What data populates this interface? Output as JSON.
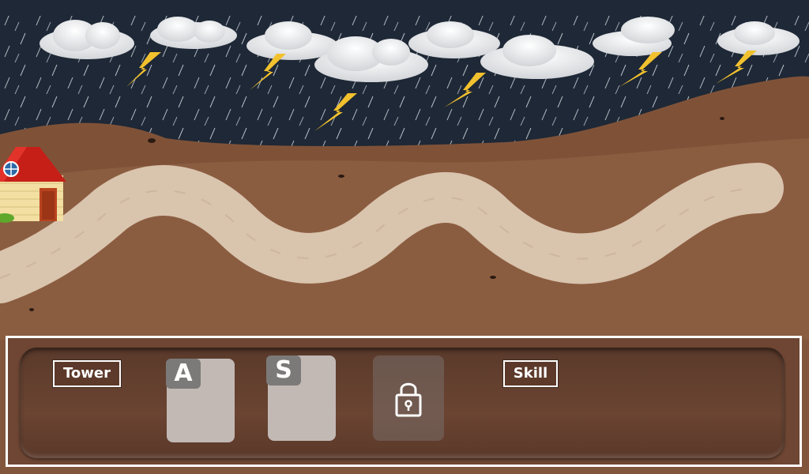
{
  "hud": {
    "tower_label": "Tower",
    "skill_label": "Skill",
    "tower_slots": [
      {
        "hotkey": "A",
        "state": "available"
      },
      {
        "hotkey": "S",
        "state": "available"
      },
      {
        "hotkey": "",
        "state": "locked",
        "icon": "lock-icon"
      }
    ]
  },
  "scene": {
    "weather": "storm",
    "icons": [
      "cloud-icon",
      "lightning-icon",
      "house-icon",
      "lock-icon"
    ],
    "colors": {
      "sky": "#1f2a3a",
      "dirt": "#8a5a3e",
      "path": "#d8c3ae",
      "lightning": "#f2c12e",
      "roof": "#d42a1e"
    }
  }
}
